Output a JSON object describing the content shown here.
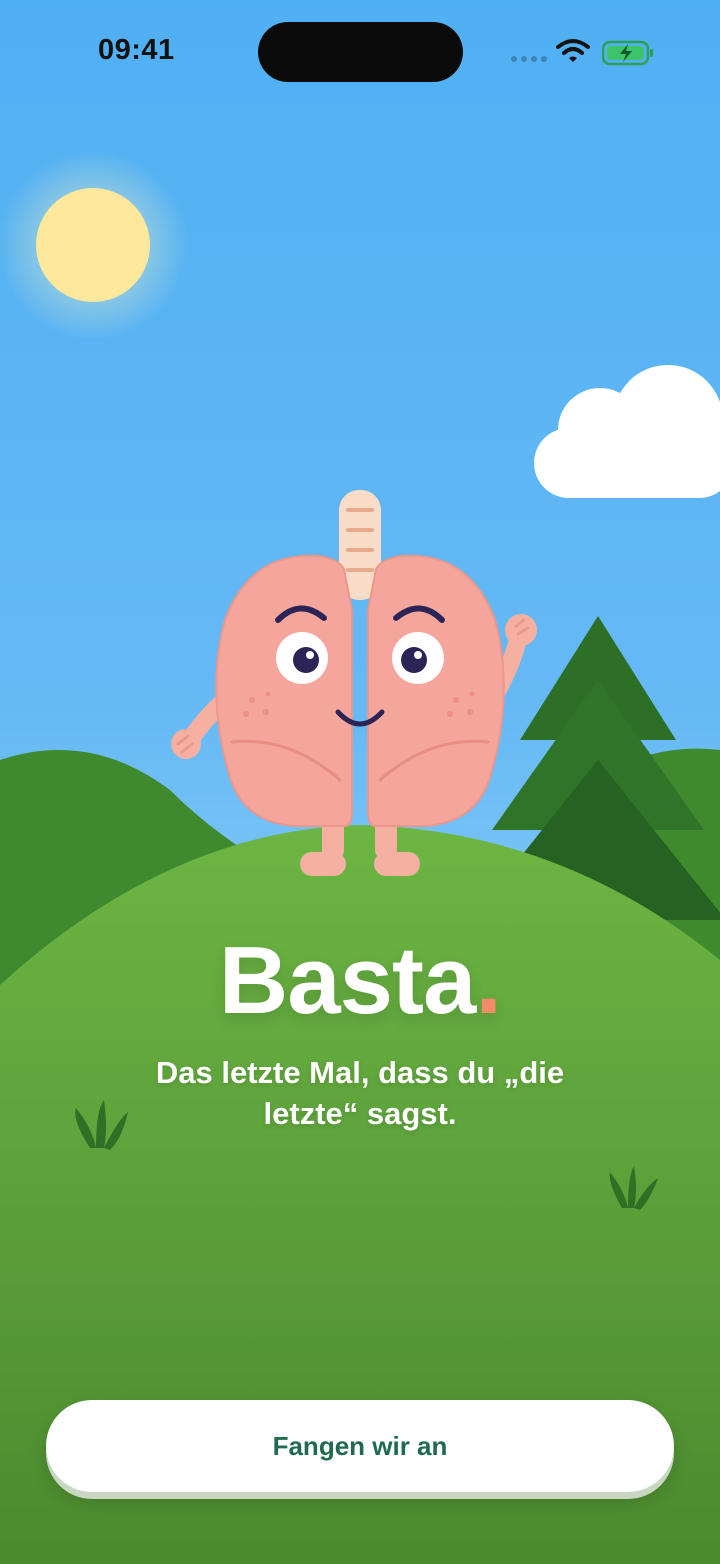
{
  "status_bar": {
    "time": "09:41"
  },
  "hero": {
    "brand_name": "Basta",
    "brand_dot": ".",
    "subtitle": "Das letzte Mal, dass du „die letzte“ sagst."
  },
  "cta": {
    "label": "Fangen wir an"
  },
  "colors": {
    "sky": "#4fb0f2",
    "grass": "#5fa63a",
    "accent_dot": "#f58a68",
    "button_text": "#1f6b4c",
    "lung": "#f5a69c"
  },
  "icons": [
    "wifi-icon",
    "battery-charging-icon",
    "signal-icon"
  ]
}
